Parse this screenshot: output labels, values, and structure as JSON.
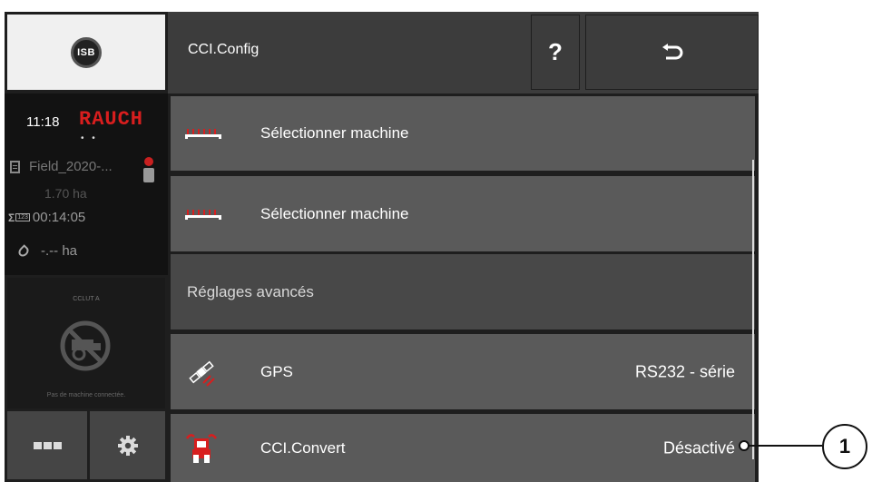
{
  "sidebar": {
    "isb_label": "ISB",
    "time": "11:18",
    "brand": "RAUCH",
    "dots": "• •",
    "field_name": "Field_2020-...",
    "area": "1.70 ha",
    "counter_sigma": "Σ",
    "counter_box": "123",
    "counter_time": "00:14:05",
    "worked_area": "-.-- ha",
    "machine_panel": {
      "title": "CCLUT A",
      "caption": "Pas de machine connectée."
    }
  },
  "header": {
    "title": "CCI.Config",
    "help_label": "?"
  },
  "rows": [
    {
      "label": "Sélectionner machine",
      "value": "",
      "icon": "implement-icon"
    },
    {
      "label": "Sélectionner machine",
      "value": "",
      "icon": "implement-icon"
    },
    {
      "label": "Réglages avancés",
      "value": "",
      "icon": ""
    },
    {
      "label": "GPS",
      "value": "RS232 - série",
      "icon": "satellite-icon"
    },
    {
      "label": "CCI.Convert",
      "value": "Désactivé",
      "icon": "tractor-convert-icon"
    }
  ],
  "callout": {
    "number": "1"
  },
  "colors": {
    "brand_red": "#d81e1e",
    "row_bg": "#5a5a5a",
    "section_bg": "#484848",
    "frame_bg": "#1e1e1e"
  }
}
